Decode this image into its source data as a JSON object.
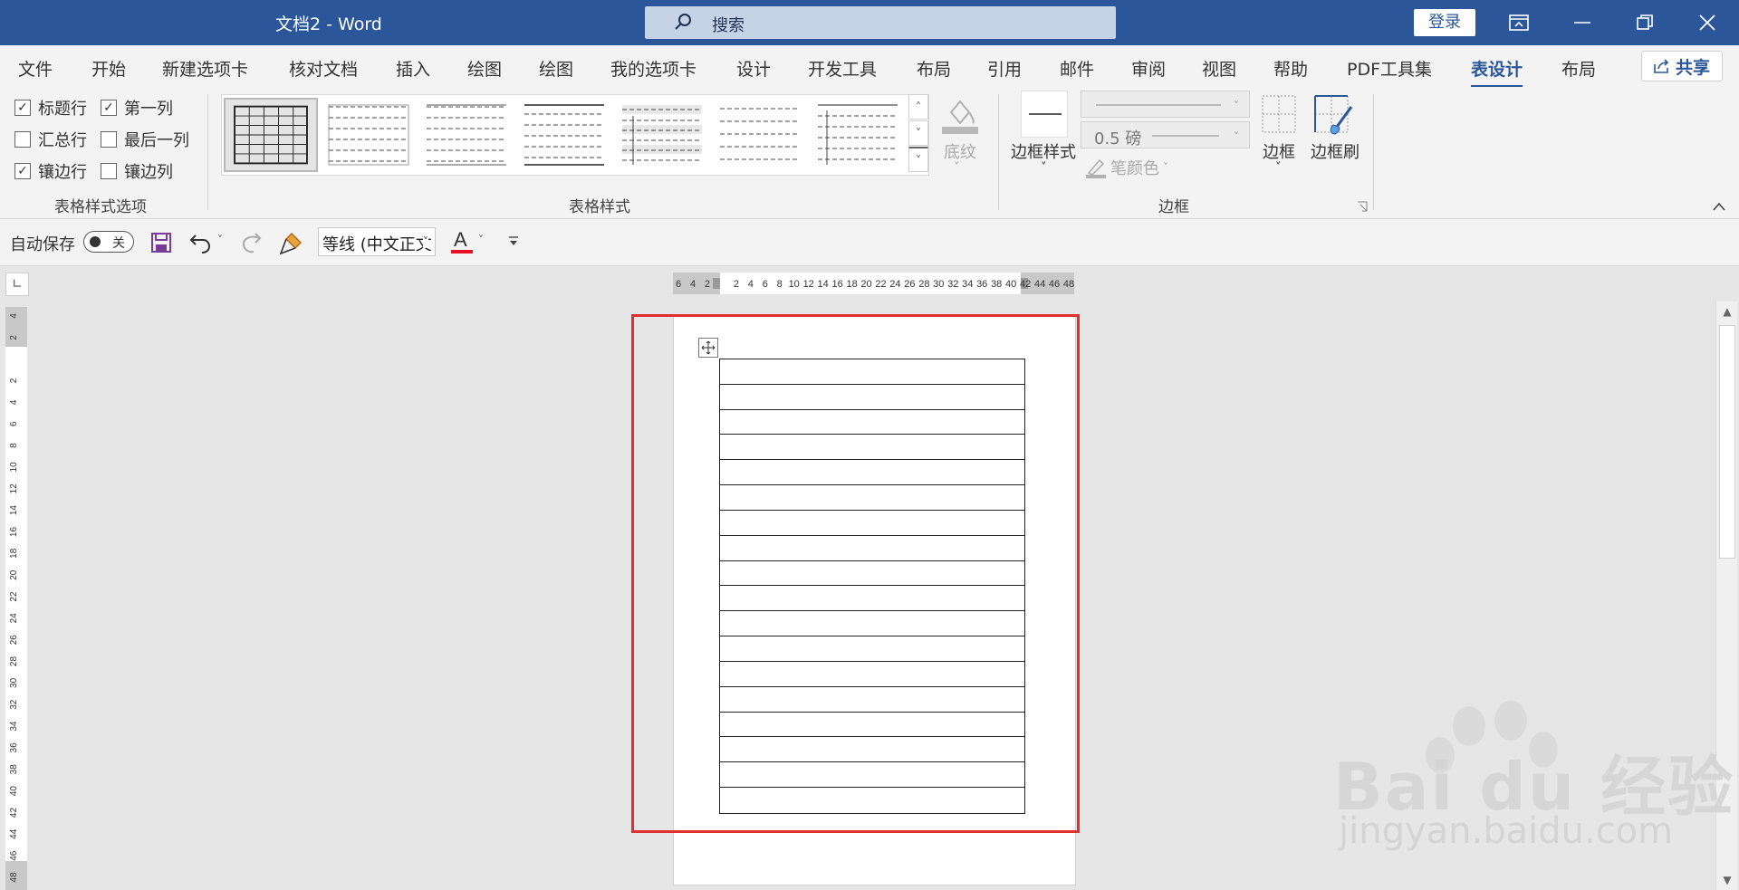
{
  "window": {
    "title": "文档2  -  Word",
    "search_placeholder": "搜索",
    "login": "登录"
  },
  "tabs": [
    "文件",
    "开始",
    "新建选项卡",
    "核对文档",
    "插入",
    "绘图",
    "绘图",
    "我的选项卡",
    "设计",
    "开发工具",
    "布局",
    "引用",
    "邮件",
    "审阅",
    "视图",
    "帮助",
    "PDF工具集",
    "表设计",
    "布局"
  ],
  "active_tab": "表设计",
  "share": "共享",
  "ribbon": {
    "style_options": {
      "header_row": {
        "label": "标题行",
        "checked": true
      },
      "first_column": {
        "label": "第一列",
        "checked": true
      },
      "total_row": {
        "label": "汇总行",
        "checked": false
      },
      "last_column": {
        "label": "最后一列",
        "checked": false
      },
      "banded_rows": {
        "label": "镶边行",
        "checked": true
      },
      "banded_columns": {
        "label": "镶边列",
        "checked": false
      },
      "group_label": "表格样式选项"
    },
    "table_styles": {
      "group_label": "表格样式",
      "shading_label": "底纹"
    },
    "borders": {
      "border_styles_label": "边框样式",
      "pen_weight": "0.5 磅",
      "pen_color_label": "笔颜色",
      "borders_label": "边框",
      "border_painter_label": "边框刷",
      "group_label": "边框"
    }
  },
  "qat": {
    "autosave_label": "自动保存",
    "autosave_state": "关",
    "font_name": "等线 (中文正文"
  },
  "ruler": {
    "h_labels": [
      "6",
      "4",
      "2",
      "",
      "2",
      "4",
      "6",
      "8",
      "10",
      "12",
      "14",
      "16",
      "18",
      "20",
      "22",
      "24",
      "26",
      "28",
      "30",
      "32",
      "34",
      "36",
      "38",
      "40",
      "42",
      "44",
      "46",
      "48"
    ],
    "v_labels": [
      "4",
      "2",
      "",
      "2",
      "4",
      "6",
      "8",
      "10",
      "12",
      "14",
      "16",
      "18",
      "20",
      "22",
      "24",
      "26",
      "28",
      "30",
      "32",
      "34",
      "36",
      "38",
      "40",
      "42",
      "44",
      "46",
      "48"
    ]
  },
  "document": {
    "table_rows": 18
  },
  "watermark": {
    "brand": "Bai du 经验",
    "url": "jingyan.baidu.com"
  },
  "colors": {
    "title_bar": "#2b579a",
    "highlight": "#e02f2f",
    "font_color_underline": "#e81123"
  }
}
